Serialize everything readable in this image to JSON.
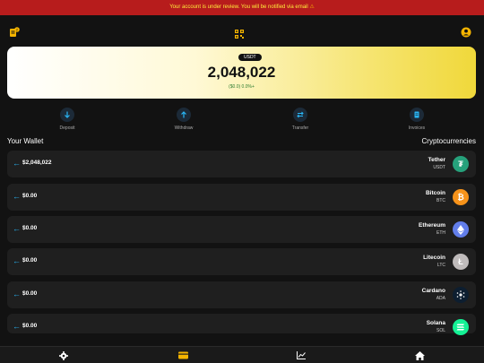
{
  "banner": {
    "text": "Your account is under review. You will be notified via email",
    "icon": "warning-icon"
  },
  "topbar": {
    "badge": "2",
    "left_icon": "receipt-icon",
    "center_icon": "qr-code-icon",
    "right_icon": "user-icon"
  },
  "hero": {
    "pill": "USDT",
    "amount": "2,048,022",
    "change": "($0.0) 0.0%+"
  },
  "actions": [
    {
      "label": "Deposit",
      "icon": "arrow-down-icon"
    },
    {
      "label": "Withdraw",
      "icon": "arrow-up-icon"
    },
    {
      "label": "Transfer",
      "icon": "swap-icon"
    },
    {
      "label": "Invoices",
      "icon": "document-icon"
    }
  ],
  "wallet": {
    "title": "Your Wallet",
    "right_title": "Cryptocurrencies",
    "rows": [
      {
        "balance": "$2,048,022",
        "name": "Tether",
        "symbol": "USDT",
        "color": "#26a17b"
      },
      {
        "balance": "$0.00",
        "name": "Bitcoin",
        "symbol": "BTC",
        "color": "#f7931a"
      },
      {
        "balance": "$0.00",
        "name": "Ethereum",
        "symbol": "ETH",
        "color": "#627eea"
      },
      {
        "balance": "$0.00",
        "name": "Litecoin",
        "symbol": "LTC",
        "color": "#bfbbbb"
      },
      {
        "balance": "$0.00",
        "name": "Cardano",
        "symbol": "ADA",
        "color": "#0d1e30"
      },
      {
        "balance": "$0.00",
        "name": "Solana",
        "symbol": "SOL",
        "color": "#14f195"
      }
    ]
  },
  "navbar": {
    "items": [
      "settings-icon",
      "wallet-icon",
      "chart-icon",
      "home-icon"
    ],
    "active_color": "#f5b400"
  }
}
